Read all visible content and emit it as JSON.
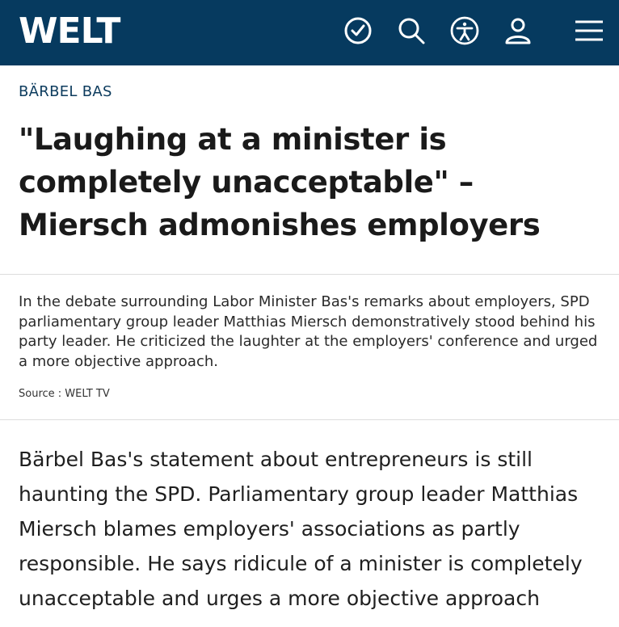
{
  "header": {
    "logo": "WELT",
    "icons": [
      "clock-icon",
      "search-icon",
      "accessibility-icon",
      "user-icon",
      "menu-icon"
    ],
    "background": "#063a5f"
  },
  "article": {
    "kicker": "BÄRBEL BAS",
    "headline": "\"Laughing at a minister is completely unacceptable\" – Miersch admonishes employers",
    "teaser": "In the debate surrounding Labor Minister Bas's remarks about employers, SPD parliamentary group leader Matthias Miersch demonstratively stood behind his party leader. He criticized the laughter at the employers' conference and urged a more objective approach.",
    "source": "Source : WELT TV",
    "body": "Bärbel Bas's statement about entrepreneurs is still haunting the SPD. Parliamentary group leader Matthias Miersch blames employers' associations as partly responsible. He says ridicule of a minister is completely unacceptable and urges a more objective approach"
  }
}
